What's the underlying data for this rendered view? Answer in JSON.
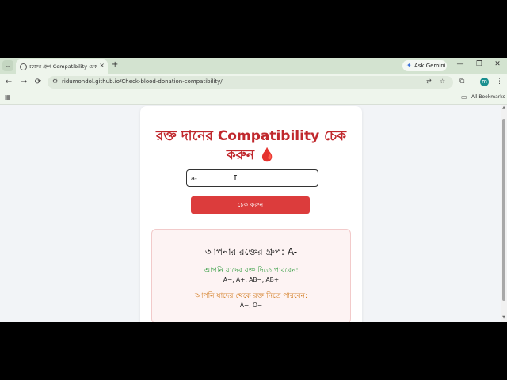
{
  "tab": {
    "title": "রক্তের গ্রুপ Compatibility চেক",
    "close": "×",
    "new": "+"
  },
  "gemini": {
    "label": "Ask Gemini",
    "icon": "✦"
  },
  "window": {
    "minimize": "—",
    "maximize": "❐",
    "close": "✕"
  },
  "toolbar": {
    "url": "ridumondol.github.io/Check-blood-donation-compatibility/",
    "profile_initial": "m"
  },
  "bookmarks": {
    "all_label": "All Bookmarks"
  },
  "page": {
    "title": "রক্ত দানের Compatibility চেক করুন",
    "title_emoji": "🩸",
    "input_value": "a-",
    "button_label": "চেক করুন",
    "result": {
      "heading": "আপনার রক্তের গ্রুপ: A-",
      "give_heading": "আপনি যাদের রক্ত দিতে পারবেন:",
      "give_list": "A−, A+, AB−, AB+",
      "receive_heading": "আপনি যাদের থেকে রক্ত নিতে পারবেন:",
      "receive_list": "A−, O−"
    }
  },
  "colors": {
    "title": "#c0282d",
    "button": "#dc3c3c",
    "give": "#2e9a3c",
    "receive": "#d27a1e"
  }
}
